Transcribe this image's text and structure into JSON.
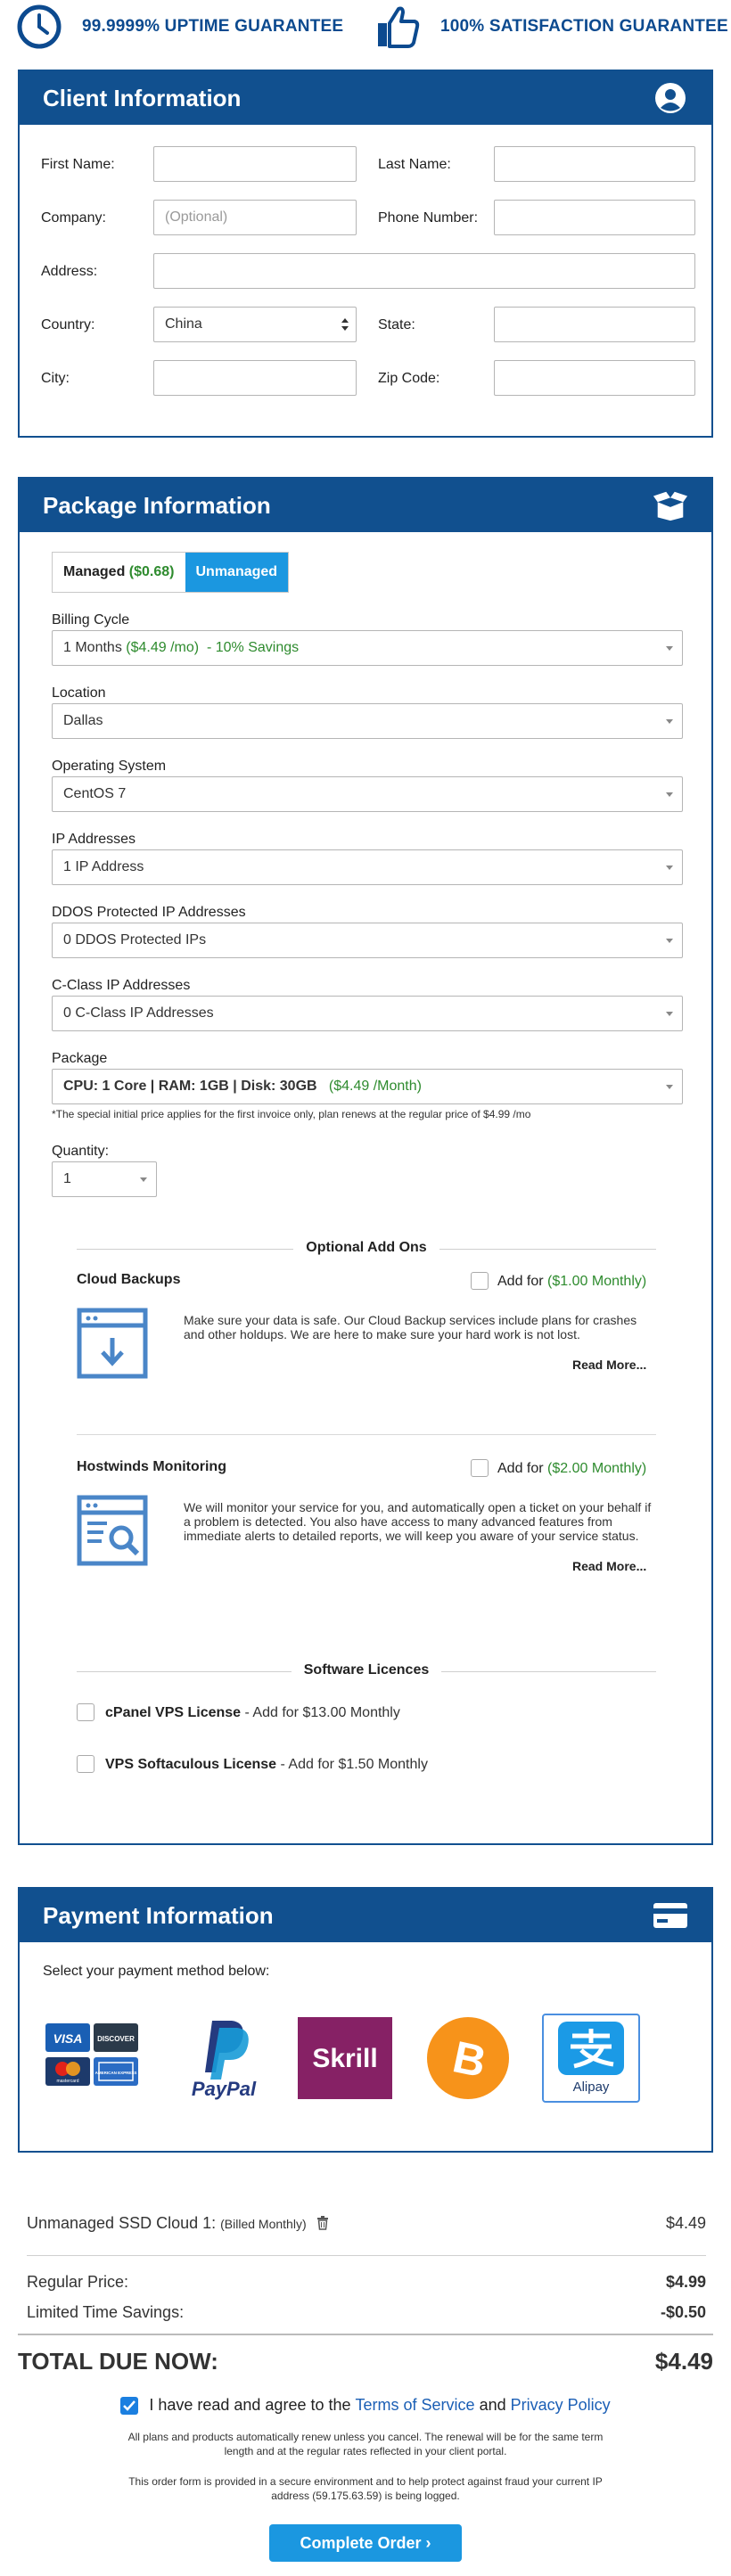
{
  "banner": {
    "uptime_text": "99.9999% UPTIME GUARANTEE",
    "satisfaction_text": "100% SATISFACTION GUARANTEE",
    "uptime_icon": "clock-icon",
    "satisfaction_icon": "thumbs-up-icon"
  },
  "client": {
    "title": "Client Information",
    "icon": "user-circle-icon",
    "first_name_label": "First Name:",
    "last_name_label": "Last Name:",
    "company_label": "Company:",
    "company_placeholder": "(Optional)",
    "phone_label": "Phone Number:",
    "address_label": "Address:",
    "country_label": "Country:",
    "country_value": "China",
    "state_label": "State:",
    "city_label": "City:",
    "zip_label": "Zip Code:"
  },
  "package": {
    "title": "Package Information",
    "icon": "open-box-icon",
    "managed_label": "Managed",
    "managed_price": "($0.68)",
    "unmanaged_label": "Unmanaged",
    "billing_label": "Billing Cycle",
    "billing_value": "1 Months",
    "billing_price": "($4.49 /mo)",
    "billing_savings": "-  10% Savings",
    "location_label": "Location",
    "location_value": "Dallas",
    "os_label": "Operating System",
    "os_value": "CentOS 7",
    "ip_label": "IP Addresses",
    "ip_value": "1 IP Address",
    "ddos_label": "DDOS Protected IP Addresses",
    "ddos_value": "0 DDOS Protected IPs",
    "cclass_label": "C-Class IP Addresses",
    "cclass_value": "0 C-Class IP Addresses",
    "package_label": "Package",
    "package_spec": "CPU: 1 Core | RAM: 1GB | Disk: 30GB",
    "package_price": "($4.49 /Month)",
    "package_note": "*The special initial price applies for the first invoice only, plan renews at the regular price of $4.99 /mo",
    "quantity_label": "Quantity:",
    "quantity_value": "1"
  },
  "addons": {
    "heading": "Optional Add Ons",
    "items": [
      {
        "name": "Cloud Backups",
        "add_text": "Add for",
        "price": "($1.00 Monthly)",
        "description": "Make sure your data is safe. Our Cloud Backup services include plans for crashes and other holdups. We are here to make sure your hard work is not lost.",
        "read_more": "Read More...",
        "icon": "backup-download-icon"
      },
      {
        "name": "Hostwinds Monitoring",
        "add_text": "Add for",
        "price": "($2.00 Monthly)",
        "description": "We will monitor your service for you, and automatically open a ticket on your behalf if a problem is detected. You also have access to many advanced features from immediate alerts to detailed reports, we will keep you aware of your service status.",
        "read_more": "Read More...",
        "icon": "monitoring-magnifier-icon"
      }
    ]
  },
  "licences": {
    "heading": "Software Licences",
    "items": [
      {
        "name": "cPanel VPS License",
        "price": "- Add for $13.00 Monthly"
      },
      {
        "name": "VPS Softaculous License",
        "price": "- Add for $1.50 Monthly"
      }
    ]
  },
  "payment": {
    "title": "Payment Information",
    "icon": "credit-card-icon",
    "intro": "Select your payment method below:",
    "methods": [
      {
        "name": "credit-cards",
        "labels": [
          "VISA",
          "DISCOVER",
          "mastercard",
          "AMERICAN EXPRESS"
        ]
      },
      {
        "name": "paypal",
        "label": "PayPal"
      },
      {
        "name": "skrill",
        "label": "Skrill"
      },
      {
        "name": "bitcoin",
        "label": "B"
      },
      {
        "name": "alipay",
        "label": "Alipay",
        "selected": true
      }
    ]
  },
  "summary": {
    "item_name": "Unmanaged SSD Cloud 1:",
    "item_billing": "(Billed Monthly)",
    "item_price": "$4.49",
    "regular_label": "Regular Price:",
    "regular_value": "$4.99",
    "savings_label": "Limited Time Savings:",
    "savings_value": "-$0.50",
    "total_label": "TOTAL DUE NOW:",
    "total_value": "$4.49",
    "agree_prefix": "I have read and agree to the",
    "terms_link": "Terms of Service",
    "and_text": "and",
    "privacy_link": "Privacy Policy",
    "renew_notice": "All plans and products automatically renew unless you cancel. The renewal will be for the same term length and at the regular rates reflected in your client portal.",
    "secure_notice": "This order form is provided in a secure environment and to help protect against fraud your current IP address (59.175.63.59) is being logged.",
    "complete_button": "Complete Order ›"
  },
  "colors": {
    "brand_blue": "#11508f",
    "accent_blue": "#1b97e0",
    "green": "#2e8b2e"
  }
}
